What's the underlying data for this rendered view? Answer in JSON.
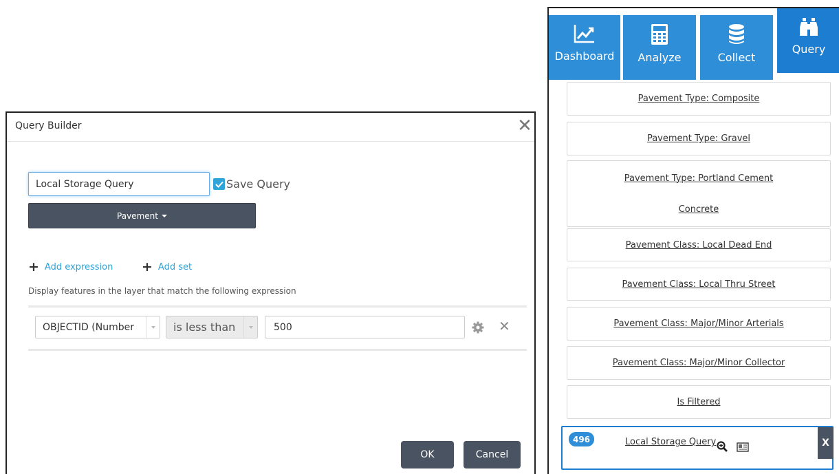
{
  "dialog": {
    "title": "Query Builder",
    "close_glyph": "✕",
    "query_name_value": "Local Storage Query",
    "save_query_label": "Save Query",
    "save_query_checked": true,
    "layer_button_label": "Pavement",
    "add_expression_label": "Add expression",
    "add_set_label": "Add set",
    "description": "Display features in the layer that match the following expression",
    "expression": {
      "field": "OBJECTID (Number",
      "operator": "is less than",
      "value": "500"
    },
    "ok_label": "OK",
    "cancel_label": "Cancel"
  },
  "panel": {
    "tabs": [
      {
        "label": "Dashboard",
        "icon": "trend-chart-icon"
      },
      {
        "label": "Analyze",
        "icon": "calculator-icon"
      },
      {
        "label": "Collect",
        "icon": "database-icon"
      },
      {
        "label": "Query",
        "icon": "binoculars-icon",
        "active": true
      }
    ],
    "queries": [
      "Pavement Type: Composite",
      "Pavement Type: Gravel",
      "Pavement Type: Portland Cement Concrete",
      "Pavement Class: Local Dead End",
      "Pavement Class: Local Thru Street",
      "Pavement Class: Major/Minor Arterials",
      "Pavement Class: Major/Minor Collector",
      "Is Filtered"
    ],
    "active_query": {
      "count": "496",
      "label": "Local Storage Query",
      "remove_label": "X"
    }
  },
  "colors": {
    "tab_blue": "#2f8ed8",
    "tab_active": "#1d7dd1",
    "dark_button": "#4a5361",
    "link_blue": "#2fa4d8"
  }
}
